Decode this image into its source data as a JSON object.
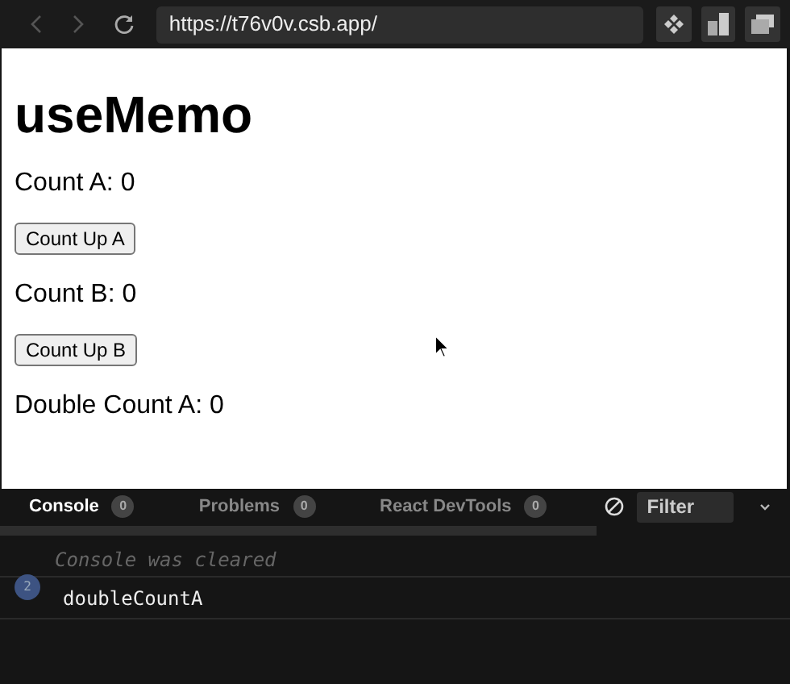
{
  "browser": {
    "url": "https://t76v0v.csb.app/"
  },
  "page": {
    "heading": "useMemo",
    "items": [
      {
        "kind": "text",
        "text": "Count A: 0"
      },
      {
        "kind": "button",
        "text": "Count Up A"
      },
      {
        "kind": "text",
        "text": "Count B: 0"
      },
      {
        "kind": "button",
        "text": "Count Up B"
      },
      {
        "kind": "text",
        "text": "Double Count A: 0"
      }
    ]
  },
  "devtools": {
    "tabs": [
      {
        "label": "Console",
        "count": "0",
        "selected": true
      },
      {
        "label": "Problems",
        "count": "0",
        "selected": false
      },
      {
        "label": "React DevTools",
        "count": "0",
        "selected": false
      }
    ],
    "filter": {
      "placeholder": "Filter"
    },
    "console": [
      {
        "kind": "info",
        "text": "Console was cleared"
      },
      {
        "kind": "log",
        "count": "2",
        "text": "doubleCountA"
      }
    ]
  }
}
